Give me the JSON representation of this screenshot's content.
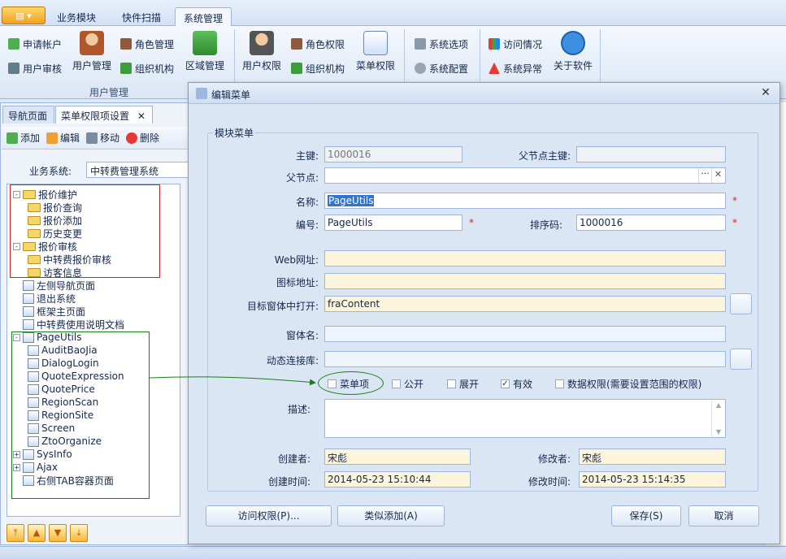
{
  "ribbon": {
    "tabs": [
      "业务模块",
      "快件扫描",
      "系统管理"
    ],
    "active_tab": "系统管理",
    "group1_label": "用户管理",
    "items": {
      "apply_account": "申请帐户",
      "user_audit": "用户审核",
      "user_manage": "用户管理",
      "role_manage": "角色管理",
      "org": "组织机构",
      "region_manage": "区域管理",
      "user_perm": "用户权限",
      "role_perm": "角色权限",
      "org2": "组织机构",
      "menu_perm": "菜单权限",
      "sys_options": "系统选项",
      "sys_config": "系统配置",
      "access": "访问情况",
      "sys_error": "系统异常",
      "about": "关于软件"
    }
  },
  "left": {
    "tabs": [
      "导航页面",
      "菜单权限项设置"
    ],
    "close_glyph": "✕",
    "toolbar": {
      "add": "添加",
      "edit": "编辑",
      "move": "移动",
      "delete": "删除"
    },
    "biz_label": "业务系统:",
    "biz_value": "中转费管理系统",
    "tree": [
      {
        "label": "报价维护",
        "kind": "folder",
        "level": 0,
        "exp": "-"
      },
      {
        "label": "报价查询",
        "kind": "folder",
        "level": 1
      },
      {
        "label": "报价添加",
        "kind": "folder",
        "level": 1
      },
      {
        "label": "历史变更",
        "kind": "folder",
        "level": 1
      },
      {
        "label": "报价审核",
        "kind": "folder",
        "level": 0,
        "exp": "-"
      },
      {
        "label": "中转费报价审核",
        "kind": "folder",
        "level": 1
      },
      {
        "label": "访客信息",
        "kind": "folder",
        "level": 1
      },
      {
        "label": "左侧导航页面",
        "kind": "page",
        "level": 0
      },
      {
        "label": "退出系统",
        "kind": "page",
        "level": 0
      },
      {
        "label": "框架主页面",
        "kind": "page",
        "level": 0
      },
      {
        "label": "中转费使用说明文档",
        "kind": "page",
        "level": 0
      },
      {
        "label": "PageUtils",
        "kind": "page",
        "level": 0,
        "exp": "-"
      },
      {
        "label": "AuditBaoJia",
        "kind": "page",
        "level": 1
      },
      {
        "label": "DialogLogin",
        "kind": "page",
        "level": 1
      },
      {
        "label": "QuoteExpression",
        "kind": "page",
        "level": 1
      },
      {
        "label": "QuotePrice",
        "kind": "page",
        "level": 1
      },
      {
        "label": "RegionScan",
        "kind": "page",
        "level": 1
      },
      {
        "label": "RegionSite",
        "kind": "page",
        "level": 1
      },
      {
        "label": "Screen",
        "kind": "page",
        "level": 1
      },
      {
        "label": "ZtoOrganize",
        "kind": "page",
        "level": 1
      },
      {
        "label": "SysInfo",
        "kind": "page",
        "level": 0,
        "exp": "+"
      },
      {
        "label": "Ajax",
        "kind": "page",
        "level": 0,
        "exp": "+"
      },
      {
        "label": "右侧TAB容器页面",
        "kind": "page",
        "level": 0
      }
    ]
  },
  "dialog": {
    "title": "编辑菜单",
    "group_title": "模块菜单",
    "labels": {
      "key": "主键:",
      "parent_key": "父节点主键:",
      "parent": "父节点:",
      "name": "名称:",
      "code": "编号:",
      "sort": "排序码:",
      "web_url": "Web网址:",
      "icon": "图标地址:",
      "target": "目标窗体中打开:",
      "form_name": "窗体名:",
      "dll": "动态连接库:",
      "desc": "描述:",
      "creator": "创建者:",
      "modifier": "修改者:",
      "create_time": "创建时间:",
      "modify_time": "修改时间:"
    },
    "values": {
      "key": "1000016",
      "parent_key": "",
      "parent": "",
      "name": "PageUtils",
      "code": "PageUtils",
      "sort": "1000016",
      "web_url": "",
      "icon": "",
      "target": "fraContent",
      "form_name": "",
      "dll": "",
      "desc": "",
      "creator": "宋彪",
      "modifier": "宋彪",
      "create_time": "2014-05-23 15:10:44",
      "modify_time": "2014-05-23 15:14:35"
    },
    "required_mark": "*",
    "checkboxes": [
      {
        "label": "菜单项",
        "checked": false
      },
      {
        "label": "公开",
        "checked": false
      },
      {
        "label": "展开",
        "checked": false
      },
      {
        "label": "有效",
        "checked": true
      },
      {
        "label": "数据权限(需要设置范围的权限)",
        "checked": false
      }
    ],
    "buttons": {
      "access": "访问权限(P)...",
      "similar": "类似添加(A)",
      "save": "保存(S)",
      "cancel": "取消"
    },
    "dots": "···",
    "clear": "✕",
    "close": "✕"
  },
  "colors": {
    "accent": "#3074d8",
    "required": "#e02020",
    "highlight_red": "#d02020",
    "highlight_green": "#1b7d1b"
  }
}
